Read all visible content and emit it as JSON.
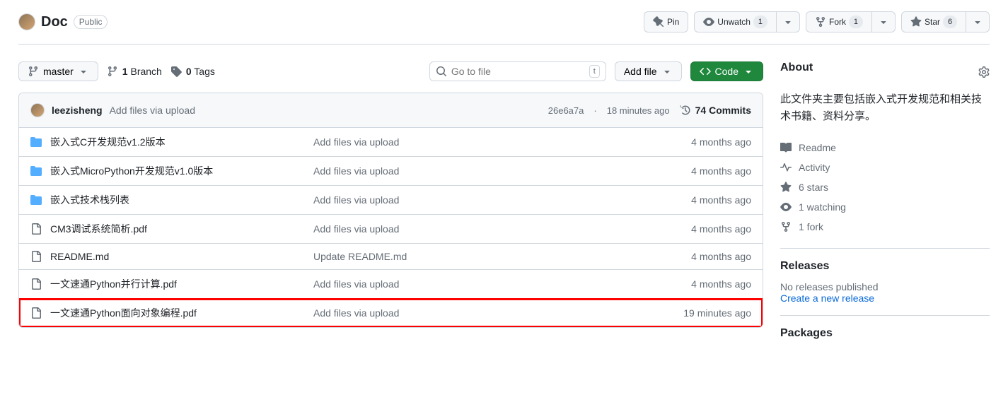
{
  "repo": {
    "name": "Doc",
    "visibility": "Public"
  },
  "actions": {
    "pin": "Pin",
    "unwatch": "Unwatch",
    "watch_count": "1",
    "fork": "Fork",
    "fork_count": "1",
    "star": "Star",
    "star_count": "6"
  },
  "toolbar": {
    "branch": "master",
    "branches_count": "1",
    "branches_label": "Branch",
    "tags_count": "0",
    "tags_label": "Tags",
    "search_placeholder": "Go to file",
    "search_kbd": "t",
    "add_file": "Add file",
    "code": "Code"
  },
  "commit": {
    "author": "leezisheng",
    "message": "Add files via upload",
    "sha": "26e6a7a",
    "time": "18 minutes ago",
    "commits_count": "74",
    "commits_label": "Commits"
  },
  "files": [
    {
      "type": "dir",
      "name": "嵌入式C开发规范v1.2版本",
      "msg": "Add files via upload",
      "date": "4 months ago",
      "hl": false
    },
    {
      "type": "dir",
      "name": "嵌入式MicroPython开发规范v1.0版本",
      "msg": "Add files via upload",
      "date": "4 months ago",
      "hl": false
    },
    {
      "type": "dir",
      "name": "嵌入式技术栈列表",
      "msg": "Add files via upload",
      "date": "4 months ago",
      "hl": false
    },
    {
      "type": "file",
      "name": "CM3调试系统简析.pdf",
      "msg": "Add files via upload",
      "date": "4 months ago",
      "hl": false
    },
    {
      "type": "file",
      "name": "README.md",
      "msg": "Update README.md",
      "date": "4 months ago",
      "hl": false
    },
    {
      "type": "file",
      "name": "一文速通Python并行计算.pdf",
      "msg": "Add files via upload",
      "date": "4 months ago",
      "hl": false
    },
    {
      "type": "file",
      "name": "一文速通Python面向对象编程.pdf",
      "msg": "Add files via upload",
      "date": "19 minutes ago",
      "hl": true
    }
  ],
  "about": {
    "heading": "About",
    "description": "此文件夹主要包括嵌入式开发规范和相关技术书籍、资料分享。",
    "links": {
      "readme": "Readme",
      "activity": "Activity",
      "stars": "6 stars",
      "watching": "1 watching",
      "forks": "1 fork"
    }
  },
  "releases": {
    "heading": "Releases",
    "none": "No releases published",
    "create": "Create a new release"
  },
  "packages": {
    "heading": "Packages"
  }
}
